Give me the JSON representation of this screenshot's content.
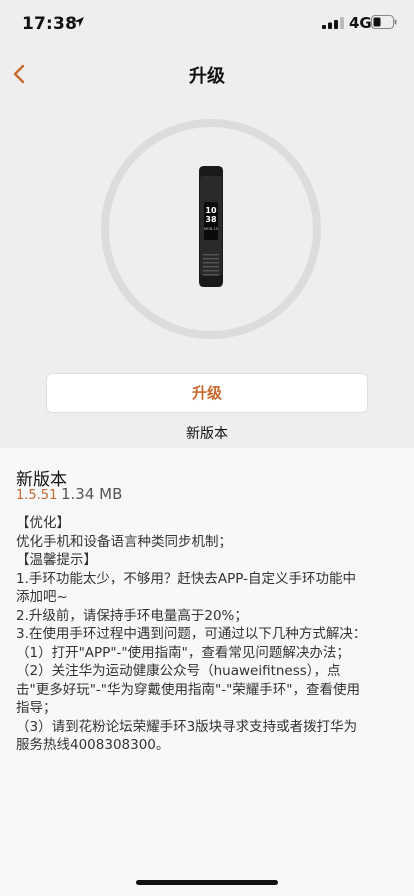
{
  "status_bar": {
    "time": "17:38",
    "network": "4G"
  },
  "nav": {
    "title": "升级"
  },
  "device": {
    "screen_time": "10",
    "screen_time2": "38",
    "screen_date": "MON 10"
  },
  "upgrade": {
    "button_label": "升级",
    "caption": "新版本"
  },
  "release": {
    "title": "新版本",
    "version": "1.5.51",
    "size": "1.34 MB",
    "notes": [
      "【优化】",
      "优化手机和设备语言种类同步机制；",
      "【温馨提示】",
      "1.手环功能太少，不够用？赶快去APP-自定义手环功能中",
      "添加吧~",
      "2.升级前，请保持手环电量高于20%；",
      "3.在使用手环过程中遇到问题，可通过以下几种方式解决：",
      "（1）打开\"APP\"-\"使用指南\"，查看常见问题解决办法；",
      "（2）关注华为运动健康公众号（huaweifitness），点",
      "击\"更多好玩\"-\"华为穿戴使用指南\"-\"荣耀手环\"，查看使用",
      "指导；",
      "（3）请到花粉论坛荣耀手环3版块寻求支持或者拨打华为",
      "服务热线4008308300。"
    ]
  },
  "colors": {
    "accent": "#c8682c",
    "top_bg": "#eeeeee",
    "panel_bg": "#f6f8fa"
  }
}
